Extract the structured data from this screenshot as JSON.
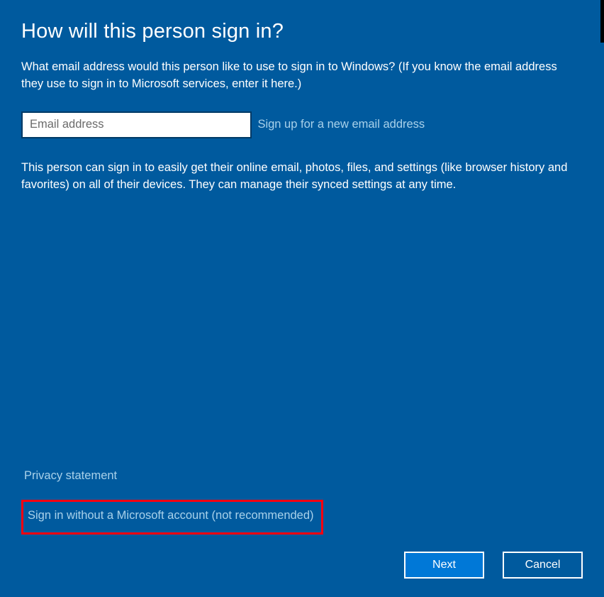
{
  "heading": "How will this person sign in?",
  "intro": "What email address would this person like to use to sign in to Windows? (If you know the email address they use to sign in to Microsoft services, enter it here.)",
  "email": {
    "placeholder": "Email address",
    "value": ""
  },
  "links": {
    "signup": "Sign up for a new email address",
    "privacy": "Privacy statement",
    "no_account": "Sign in without a Microsoft account (not recommended)"
  },
  "description": "This person can sign in to easily get their online email, photos, files, and settings (like browser history and favorites) on all of their devices. They can manage their synced settings at any time.",
  "buttons": {
    "next": "Next",
    "cancel": "Cancel"
  }
}
